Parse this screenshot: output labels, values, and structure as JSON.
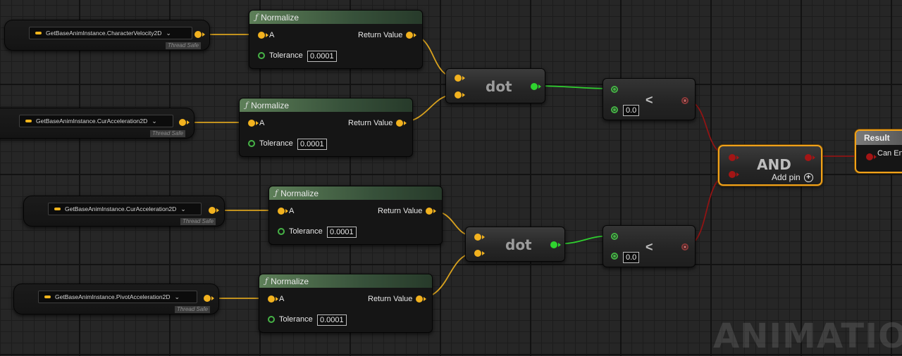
{
  "colors": {
    "float_wire": "#f2b21f",
    "bool_output_wire": "#2fd42f",
    "bool_wire_red": "#a41515",
    "function_header": "#4f6d4b",
    "selection_outline": "#f0a21a"
  },
  "getters": [
    {
      "variable": "GetBaseAnimInstance.CharacterVelocity2D",
      "badge": "Thread Safe"
    },
    {
      "variable": "GetBaseAnimInstance.CurAcceleration2D",
      "badge": "Thread Safe"
    },
    {
      "variable": "GetBaseAnimInstance.CurAcceleration2D",
      "badge": "Thread Safe"
    },
    {
      "variable": "GetBaseAnimInstance.PivotAcceleration2D",
      "badge": "Thread Safe"
    }
  ],
  "normalize_nodes": [
    {
      "title": "Normalize",
      "in_label": "A",
      "out_label": "Return Value",
      "tol_label": "Tolerance",
      "tol_value": "0.0001"
    },
    {
      "title": "Normalize",
      "in_label": "A",
      "out_label": "Return Value",
      "tol_label": "Tolerance",
      "tol_value": "0.0001"
    },
    {
      "title": "Normalize",
      "in_label": "A",
      "out_label": "Return Value",
      "tol_label": "Tolerance",
      "tol_value": "0.0001"
    },
    {
      "title": "Normalize",
      "in_label": "A",
      "out_label": "Return Value",
      "tol_label": "Tolerance",
      "tol_value": "0.0001"
    }
  ],
  "dot_nodes": [
    {
      "title": "dot"
    },
    {
      "title": "dot"
    }
  ],
  "less_nodes": [
    {
      "title": "<",
      "value": "0.0"
    },
    {
      "title": "<",
      "value": "0.0"
    }
  ],
  "and_node": {
    "title": "AND",
    "add_pin": "Add pin"
  },
  "result_node": {
    "title": "Result",
    "pin_label": "Can En"
  },
  "watermark": "ANIMATION",
  "icons": {
    "function": "function-icon",
    "dropdown": "chevron-down-icon",
    "add": "plus-circle-icon"
  }
}
